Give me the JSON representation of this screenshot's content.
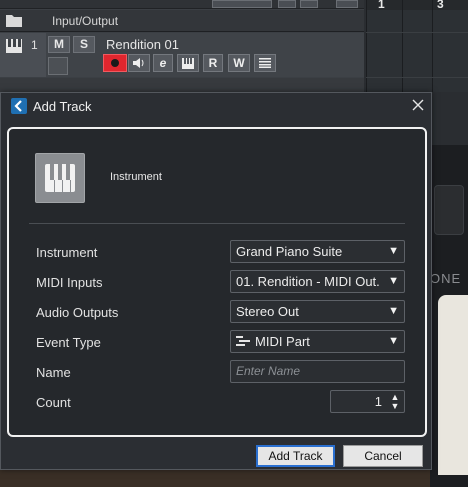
{
  "tracklist": {
    "folder_label": "Input/Output",
    "track": {
      "number": "1",
      "mute_label": "M",
      "solo_label": "S",
      "name": "Rendition 01",
      "read_label": "R",
      "write_label": "W",
      "edit_label": "e"
    }
  },
  "ruler": {
    "bar1": "1",
    "bar3": "3"
  },
  "plugin": {
    "fragment_text": "ONE"
  },
  "dialog": {
    "title": "Add Track",
    "track_type_label": "Instrument",
    "fields": {
      "instrument": {
        "label": "Instrument",
        "value": "Grand Piano Suite"
      },
      "midi_inputs": {
        "label": "MIDI Inputs",
        "value": "01. Rendition - MIDI Out."
      },
      "audio_outputs": {
        "label": "Audio Outputs",
        "value": "Stereo Out"
      },
      "event_type": {
        "label": "Event Type",
        "value": "MIDI Part"
      },
      "name": {
        "label": "Name",
        "placeholder": "Enter Name"
      },
      "count": {
        "label": "Count",
        "value": "1"
      }
    },
    "buttons": {
      "add": "Add Track",
      "cancel": "Cancel"
    }
  },
  "colors": {
    "accent_blue": "#2a6fd0",
    "record_red": "#e0262e",
    "dialog_bg": "#2b2e33",
    "panel_border": "#f2f2f2"
  },
  "icons": [
    "folder-icon",
    "keyboard-icon",
    "record-icon",
    "monitor-icon",
    "edit-icon",
    "piano-icon",
    "list-icon",
    "app-icon",
    "close-icon",
    "chevron-down-icon",
    "midi-part-icon",
    "spinner-up-icon",
    "spinner-down-icon"
  ]
}
